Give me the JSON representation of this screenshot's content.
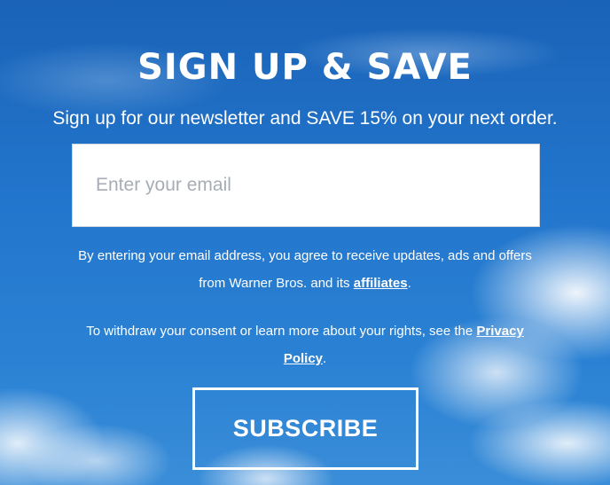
{
  "signup": {
    "title": "SIGN UP & SAVE",
    "subtitle": "Sign up for our newsletter and SAVE 15% on your next order.",
    "email_placeholder": "Enter your email",
    "email_value": "",
    "consent_text_before": "By entering your email address, you agree to receive updates, ads and offers from Warner Bros. and its ",
    "consent_link": "affiliates",
    "consent_text_after": ".",
    "withdraw_text_before": "To withdraw your consent or learn more about your rights, see the ",
    "withdraw_link": "Privacy Policy",
    "withdraw_text_after": ".",
    "subscribe_label": "SUBSCRIBE"
  },
  "colors": {
    "sky_blue": "#2275cc",
    "text": "#ffffff",
    "input_background": "#ffffff",
    "placeholder": "#a6adb4"
  }
}
